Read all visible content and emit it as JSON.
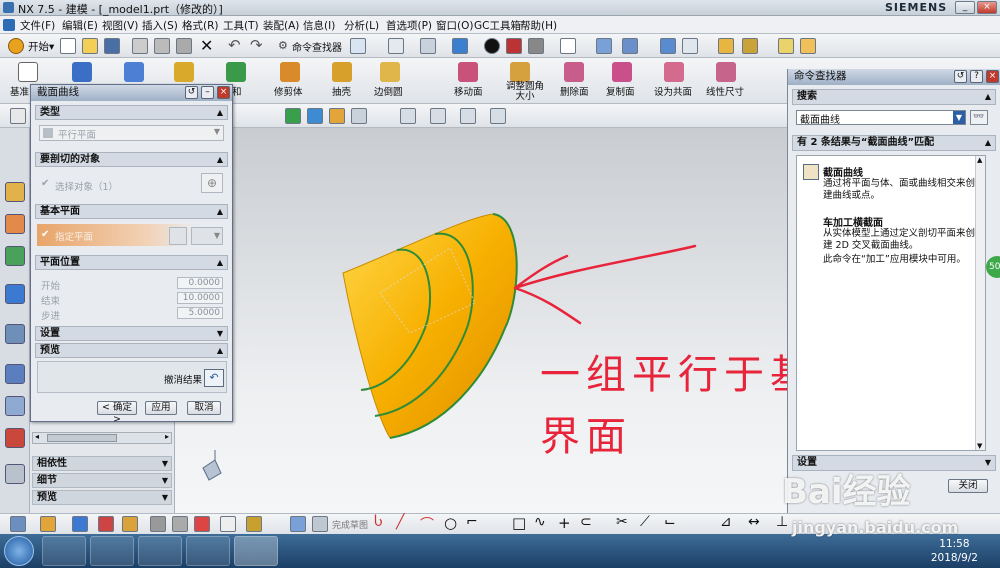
{
  "window": {
    "title": "NX 7.5 - 建模 - [_model1.prt（修改的）]",
    "brand": "SIEMENS",
    "min": "_",
    "max": "□",
    "close": "×"
  },
  "menu": [
    "文件(F)",
    "编辑(E)",
    "视图(V)",
    "插入(S)",
    "格式(R)",
    "工具(T)",
    "装配(A)",
    "信息(I)",
    "分析(L)",
    "首选项(P)",
    "窗口(O)",
    "GC工具箱",
    "帮助(H)"
  ],
  "toolbar1": {
    "start_label": "开始▾",
    "command_finder_label": "命令查找器"
  },
  "toolbar2": {
    "left_labels": [
      "基准",
      "和",
      "修剪体",
      "抽壳",
      "边倒圆"
    ],
    "right_labels": [
      "移动面",
      "调整圆角大小",
      "删除面",
      "复制面",
      "设为共面",
      "线性尺寸"
    ]
  },
  "dialog": {
    "title": "截面曲线",
    "sections": {
      "type": "类型",
      "objects": "要剖切的对象",
      "base_plane": "基本平面",
      "plane_position": "平面位置",
      "settings": "设置",
      "preview": "预览"
    },
    "type_value": "平行平面",
    "select_object": "选择对象（1）",
    "specify_plane": "指定平面",
    "start_label": "开始",
    "start_value": "0.0000",
    "end_label": "结束",
    "end_value": "10.0000",
    "step_label": "步进",
    "step_value": "5.0000",
    "undo_result": "撤消结果",
    "ok": "< 确定 >",
    "apply": "应用",
    "cancel": "取消"
  },
  "navigator": {
    "rows": [
      "相依性",
      "细节",
      "预览"
    ]
  },
  "command_finder": {
    "title": "命令查找器",
    "search_header": "搜索",
    "search_value": "截面曲线",
    "results_header": "有 2 条结果与“截面曲线”匹配",
    "results": [
      {
        "title": "截面曲线",
        "desc": "通过将平面与体、面或曲线相交来创建曲线或点。"
      },
      {
        "title": "车加工横截面",
        "desc": "从实体模型上通过定义剖切平面来创建 2D 交叉截面曲线。",
        "desc2": "此命令在“加工”应用模块中可用。"
      }
    ],
    "settings_header": "设置",
    "close_button": "关闭"
  },
  "bottom_toolbar": {
    "finish_sketch": "完成草图"
  },
  "annotation": {
    "line1": "一组平行于基准面的",
    "line2": "界面"
  },
  "side_badge": "50",
  "watermark": {
    "brand": "Bai经验",
    "url": "jingyan.baidu.com"
  },
  "taskbar": {
    "time": "11:58",
    "date": "2018/9/2"
  },
  "colors": {
    "cone": "#f7b000",
    "section_curve": "#2e8b3a",
    "annotation": "#e8243a",
    "taskbar": "#1b3f66"
  }
}
